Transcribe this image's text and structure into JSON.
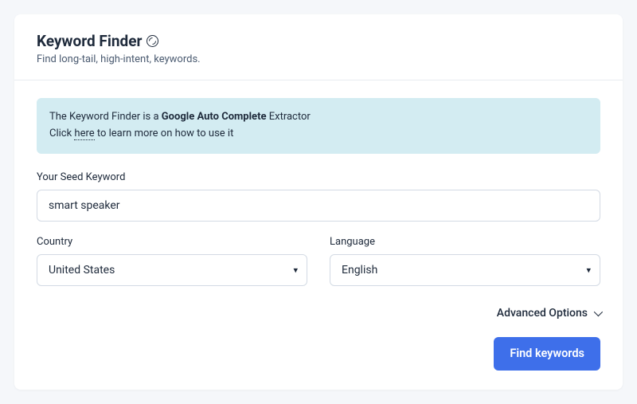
{
  "header": {
    "title": "Keyword Finder",
    "subtitle": "Find long-tail, high-intent, keywords."
  },
  "info": {
    "line1_prefix": "The Keyword Finder is a ",
    "line1_bold": "Google Auto Complete",
    "line1_suffix": " Extractor",
    "line2_prefix": "Click ",
    "line2_link": "here",
    "line2_suffix": " to learn more on how to use it"
  },
  "form": {
    "seed_label": "Your Seed Keyword",
    "seed_value": "smart speaker",
    "country_label": "Country",
    "country_value": "United States",
    "language_label": "Language",
    "language_value": "English",
    "advanced_label": "Advanced Options",
    "submit_label": "Find keywords"
  }
}
